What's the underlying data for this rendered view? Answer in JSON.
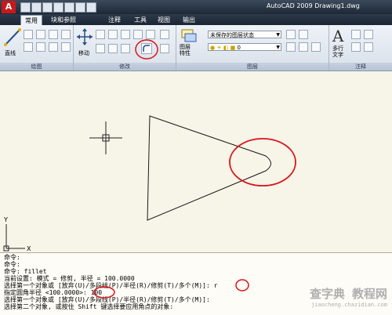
{
  "app": {
    "logo_letter": "A",
    "title": "AutoCAD 2009 Drawing1.dwg"
  },
  "tabs": [
    {
      "label": "常用"
    },
    {
      "label": "块和参照"
    },
    {
      "label": "注释"
    },
    {
      "label": "工具"
    },
    {
      "label": "视图"
    },
    {
      "label": "输出"
    }
  ],
  "ribbon": {
    "draw": {
      "line_label": "直线",
      "title": "绘图"
    },
    "modify": {
      "move_label": "移动",
      "title": "修改"
    },
    "layers": {
      "layer_props_label": "图层\n特性",
      "state_dropdown": "未保存的图层状态",
      "layer_dropdown": "0",
      "title": "图层"
    },
    "annotation": {
      "text_glyph": "A",
      "text_label": "多行\n文字",
      "title": "注释"
    }
  },
  "canvas": {
    "ucs_y": "Y",
    "ucs_x": "X",
    "colors": {
      "highlight": "#d8141a",
      "lines": "#1a1a1a"
    }
  },
  "command": {
    "lines": [
      "命令:",
      "命令:",
      "命令:  fillet",
      "当前设置: 模式 = 修剪, 半径 = 100.0000",
      "选择第一个对象或 [放弃(U)/多段线(P)/半径(R)/修剪(T)/多个(M)]: r",
      "指定圆角半径 <100.0000>: 100",
      "选择第一个对象或 [放弃(U)/多段线(P)/半径(R)/修剪(T)/多个(M)]:",
      "选择第二个对象, 或按住 Shift 键选择要应用角点的对象:"
    ]
  },
  "watermark": {
    "main": "查字典 教程网",
    "sub": "jiaocheng.chazidian.com"
  }
}
